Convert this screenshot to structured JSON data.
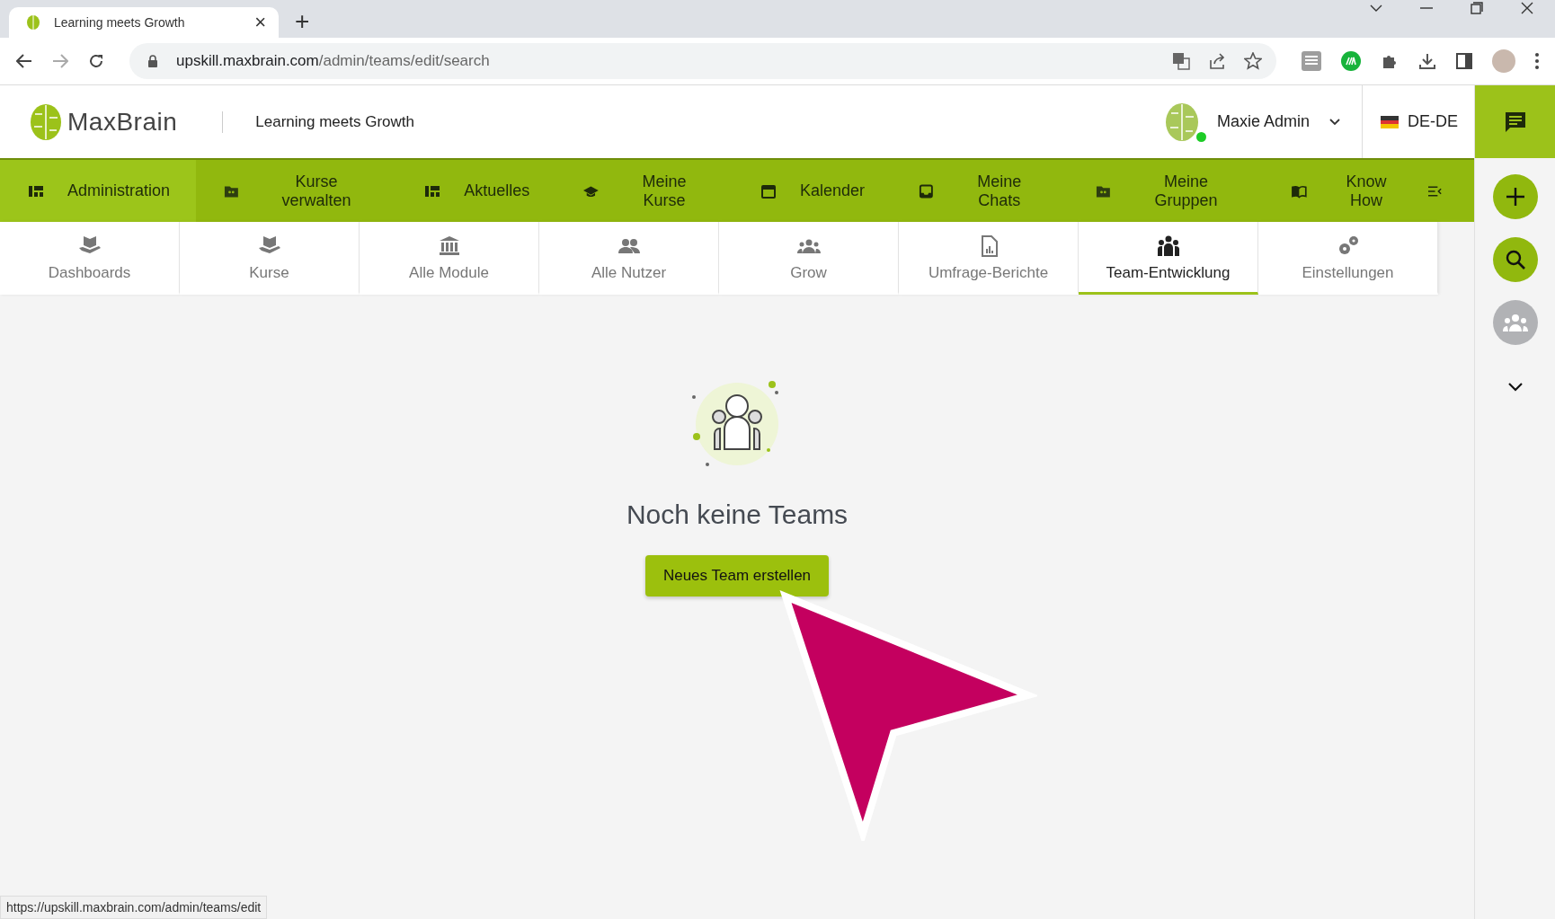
{
  "browser": {
    "tab_title": "Learning meets Growth",
    "tab_close": "×",
    "new_tab": "+",
    "url": {
      "host": "upskill.maxbrain.com",
      "path": "/admin/teams/edit/search"
    }
  },
  "header": {
    "logo": "**Max**Brain",
    "tagline": "Learning meets Growth",
    "user_name": "Maxie Admin",
    "user_online": true,
    "language": "DE-DE"
  },
  "nav": [
    {
      "label": "Administration",
      "selected": true
    },
    {
      "label": "Kurse verwalten",
      "selected": false
    },
    {
      "label": "Aktuelles",
      "selected": false
    },
    {
      "label": "Meine Kurse",
      "selected": false
    },
    {
      "label": "Kalender",
      "selected": false
    },
    {
      "label": "Meine Chats",
      "selected": false
    },
    {
      "label": "Meine Gruppen",
      "selected": false
    },
    {
      "label": "Know How",
      "selected": false
    }
  ],
  "subtabs": [
    {
      "label": "Dashboards",
      "selected": false
    },
    {
      "label": "Kurse",
      "selected": false
    },
    {
      "label": "Alle Module",
      "selected": false
    },
    {
      "label": "Alle Nutzer",
      "selected": false
    },
    {
      "label": "Grow",
      "selected": false
    },
    {
      "label": "Umfrage-Berichte",
      "selected": false
    },
    {
      "label": "Team-Entwicklung",
      "selected": true
    },
    {
      "label": "Einstellungen",
      "selected": false
    }
  ],
  "empty_state": {
    "title": "Noch keine Teams",
    "button": "Neues Team erstellen"
  },
  "status_bar": "https://upskill.maxbrain.com/admin/teams/edit"
}
